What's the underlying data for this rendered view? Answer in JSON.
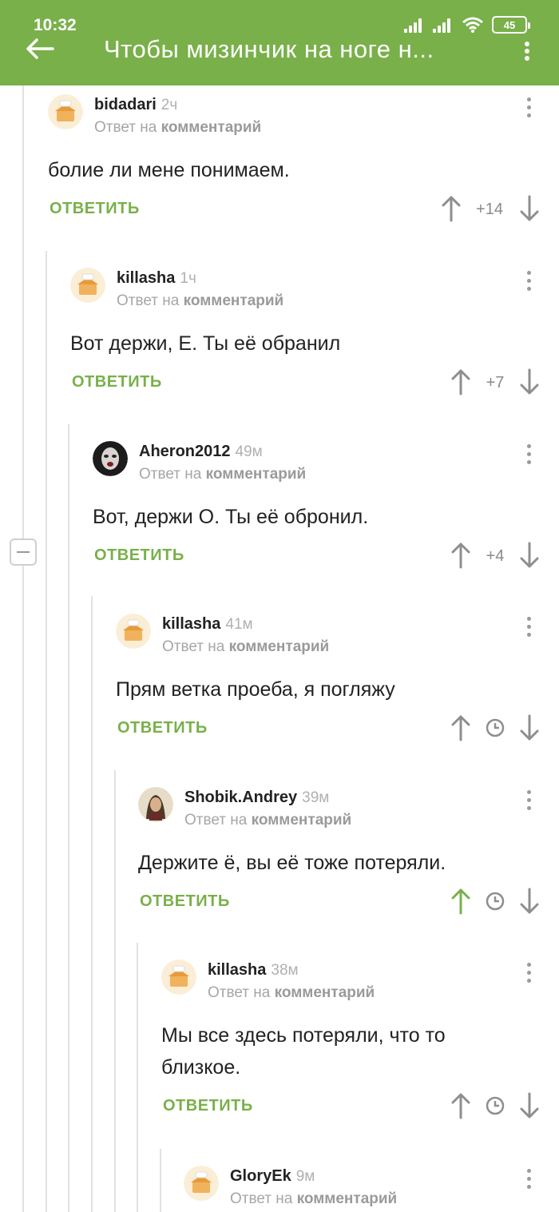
{
  "status": {
    "time": "10:32",
    "battery": "45"
  },
  "header": {
    "title": "Чтобы мизинчик на ноге н..."
  },
  "colors": {
    "accent": "#79b04a",
    "upvoted": "#79b04a",
    "neutral_arrow": "#8e8e8e"
  },
  "comments": [
    {
      "author": "bidadari",
      "time": "2ч",
      "reply_prefix": "Ответ на",
      "reply_target": "комментарий",
      "text": "болие ли мене понимаем.",
      "reply_label": "ОТВЕТИТЬ",
      "rating": "+14",
      "avatar": "default-avatar-icon"
    },
    {
      "author": "killasha",
      "time": "1ч",
      "reply_prefix": "Ответ на",
      "reply_target": "комментарий",
      "text": "Вот держи, Е. Ты её обранил",
      "reply_label": "ОТВЕТИТЬ",
      "rating": "+7",
      "avatar": "default-avatar-icon"
    },
    {
      "author": "Aheron2012",
      "time": "49м",
      "reply_prefix": "Ответ на",
      "reply_target": "комментарий",
      "text": "Вот, держи О. Ты её обронил.",
      "reply_label": "ОТВЕТИТЬ",
      "rating": "+4",
      "avatar": "user-photo-avatar"
    },
    {
      "author": "killasha",
      "time": "41м",
      "reply_prefix": "Ответ на",
      "reply_target": "комментарий",
      "text": "Прям ветка проеба, я погляжу",
      "reply_label": "ОТВЕТИТЬ",
      "rating": "",
      "avatar": "default-avatar-icon"
    },
    {
      "author": "Shobik.Andrey",
      "time": "39м",
      "reply_prefix": "Ответ на",
      "reply_target": "комментарий",
      "text": "Держите ё, вы её тоже потеряли.",
      "reply_label": "ОТВЕТИТЬ",
      "rating": "",
      "upvoted": true,
      "avatar": "user-photo-avatar"
    },
    {
      "author": "killasha",
      "time": "38м",
      "reply_prefix": "Ответ на",
      "reply_target": "комментарий",
      "text": "Мы все здесь потеряли, что то близкое.",
      "reply_label": "ОТВЕТИТЬ",
      "rating": "",
      "avatar": "default-avatar-icon"
    },
    {
      "author": "GloryEk",
      "time": "9м",
      "reply_prefix": "Ответ на",
      "reply_target": "комментарий",
      "avatar": "default-avatar-icon"
    }
  ]
}
